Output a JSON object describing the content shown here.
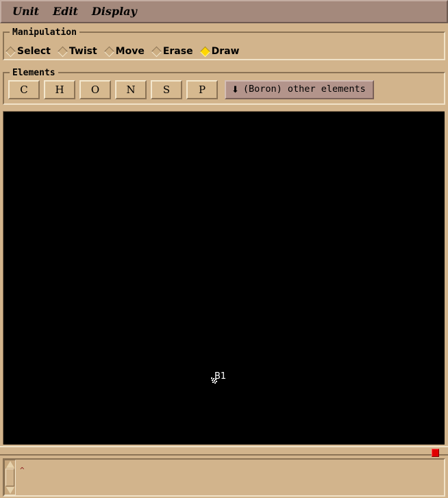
{
  "app": {
    "background_color": "#d2b48c",
    "menubar_color": "#a4897c",
    "canvas_color": "#000000",
    "accent_color": "#ffd700"
  },
  "menubar": {
    "items": [
      {
        "label": "Unit"
      },
      {
        "label": "Edit"
      },
      {
        "label": "Display"
      }
    ]
  },
  "manipulation": {
    "group_label": "Manipulation",
    "options": [
      {
        "label": "Select",
        "selected": false
      },
      {
        "label": "Twist",
        "selected": false
      },
      {
        "label": "Move",
        "selected": false
      },
      {
        "label": "Erase",
        "selected": false
      },
      {
        "label": "Draw",
        "selected": true
      }
    ]
  },
  "elements": {
    "group_label": "Elements",
    "buttons": [
      {
        "label": "C"
      },
      {
        "label": "H"
      },
      {
        "label": "O"
      },
      {
        "label": "N"
      },
      {
        "label": "S"
      },
      {
        "label": "P"
      }
    ],
    "other": {
      "arrow_icon": "⬇",
      "label": "(Boron) other elements"
    }
  },
  "canvas": {
    "atom_label": "B1",
    "cursor_icon": "draw-crosshair-cursor"
  },
  "console": {
    "text": "",
    "caret": "^",
    "scrollbar": {
      "up_icon": "triangle-up-icon",
      "down_icon": "triangle-down-icon"
    }
  },
  "resize_grip": {
    "color": "#e00000"
  }
}
